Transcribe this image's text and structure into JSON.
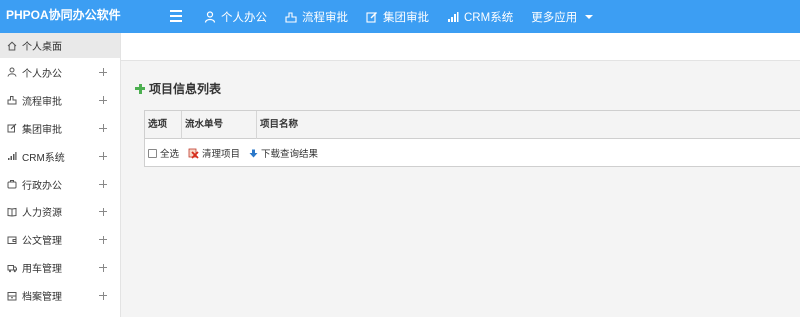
{
  "app": {
    "title": "PHPOA协同办公软件"
  },
  "topnav": {
    "items": [
      {
        "label": "个人办公",
        "icon": "user-icon"
      },
      {
        "label": "流程审批",
        "icon": "flow-icon"
      },
      {
        "label": "集团审批",
        "icon": "edit-icon"
      },
      {
        "label": "CRM系统",
        "icon": "bar-chart-icon"
      }
    ],
    "more_label": "更多应用"
  },
  "sidebar": {
    "items": [
      {
        "label": "个人桌面",
        "icon": "home-icon",
        "active": true
      },
      {
        "label": "个人办公",
        "icon": "user-icon"
      },
      {
        "label": "流程审批",
        "icon": "flow-icon"
      },
      {
        "label": "集团审批",
        "icon": "edit-icon"
      },
      {
        "label": "CRM系统",
        "icon": "bar-chart-icon"
      },
      {
        "label": "行政办公",
        "icon": "briefcase-icon"
      },
      {
        "label": "人力资源",
        "icon": "book-icon"
      },
      {
        "label": "公文管理",
        "icon": "wallet-icon"
      },
      {
        "label": "用车管理",
        "icon": "truck-icon"
      },
      {
        "label": "档案管理",
        "icon": "archive-icon"
      }
    ]
  },
  "main": {
    "section_title": "项目信息列表",
    "grid": {
      "columns": [
        "选项",
        "流水单号",
        "项目名称"
      ],
      "select_all_label": "全选",
      "clear_label": "清理项目",
      "download_label": "下载查询结果"
    }
  },
  "colors": {
    "topbar": "#3c9ef3",
    "active_item": "#e9e9e9",
    "accent_green": "#4caf50"
  }
}
